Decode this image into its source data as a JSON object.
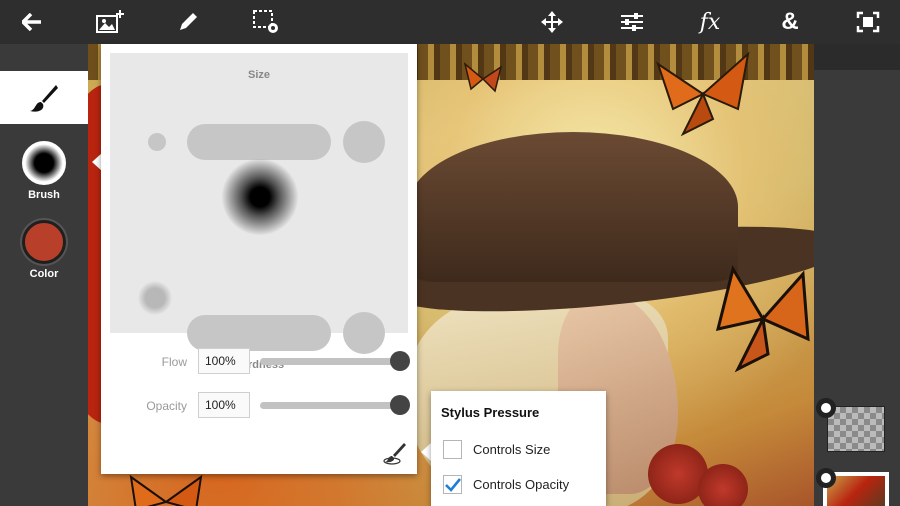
{
  "toolbar": {
    "left": [
      {
        "name": "back-arrow-icon"
      },
      {
        "name": "add-image-icon"
      },
      {
        "name": "pencil-icon"
      },
      {
        "name": "selection-settings-icon"
      }
    ],
    "right": [
      {
        "name": "move-icon"
      },
      {
        "name": "adjustments-icon"
      },
      {
        "name": "effects-icon",
        "label": "fx"
      },
      {
        "name": "combine-icon",
        "label": "&"
      },
      {
        "name": "fullscreen-icon"
      }
    ]
  },
  "left_rail": {
    "brush_label": "Brush",
    "color_label": "Color",
    "current_color": "#b8402a"
  },
  "brush_panel": {
    "size_label": "Size",
    "hardness_label": "Hardness",
    "flow": {
      "label": "Flow",
      "value": "100%",
      "level": 1.0
    },
    "opacity": {
      "label": "Opacity",
      "value": "100%",
      "level": 1.0
    }
  },
  "stylus_popup": {
    "title": "Stylus Pressure",
    "options": [
      {
        "label": "Controls Size",
        "checked": false
      },
      {
        "label": "Controls Opacity",
        "checked": true
      }
    ],
    "accent": "#1e7fd6"
  }
}
